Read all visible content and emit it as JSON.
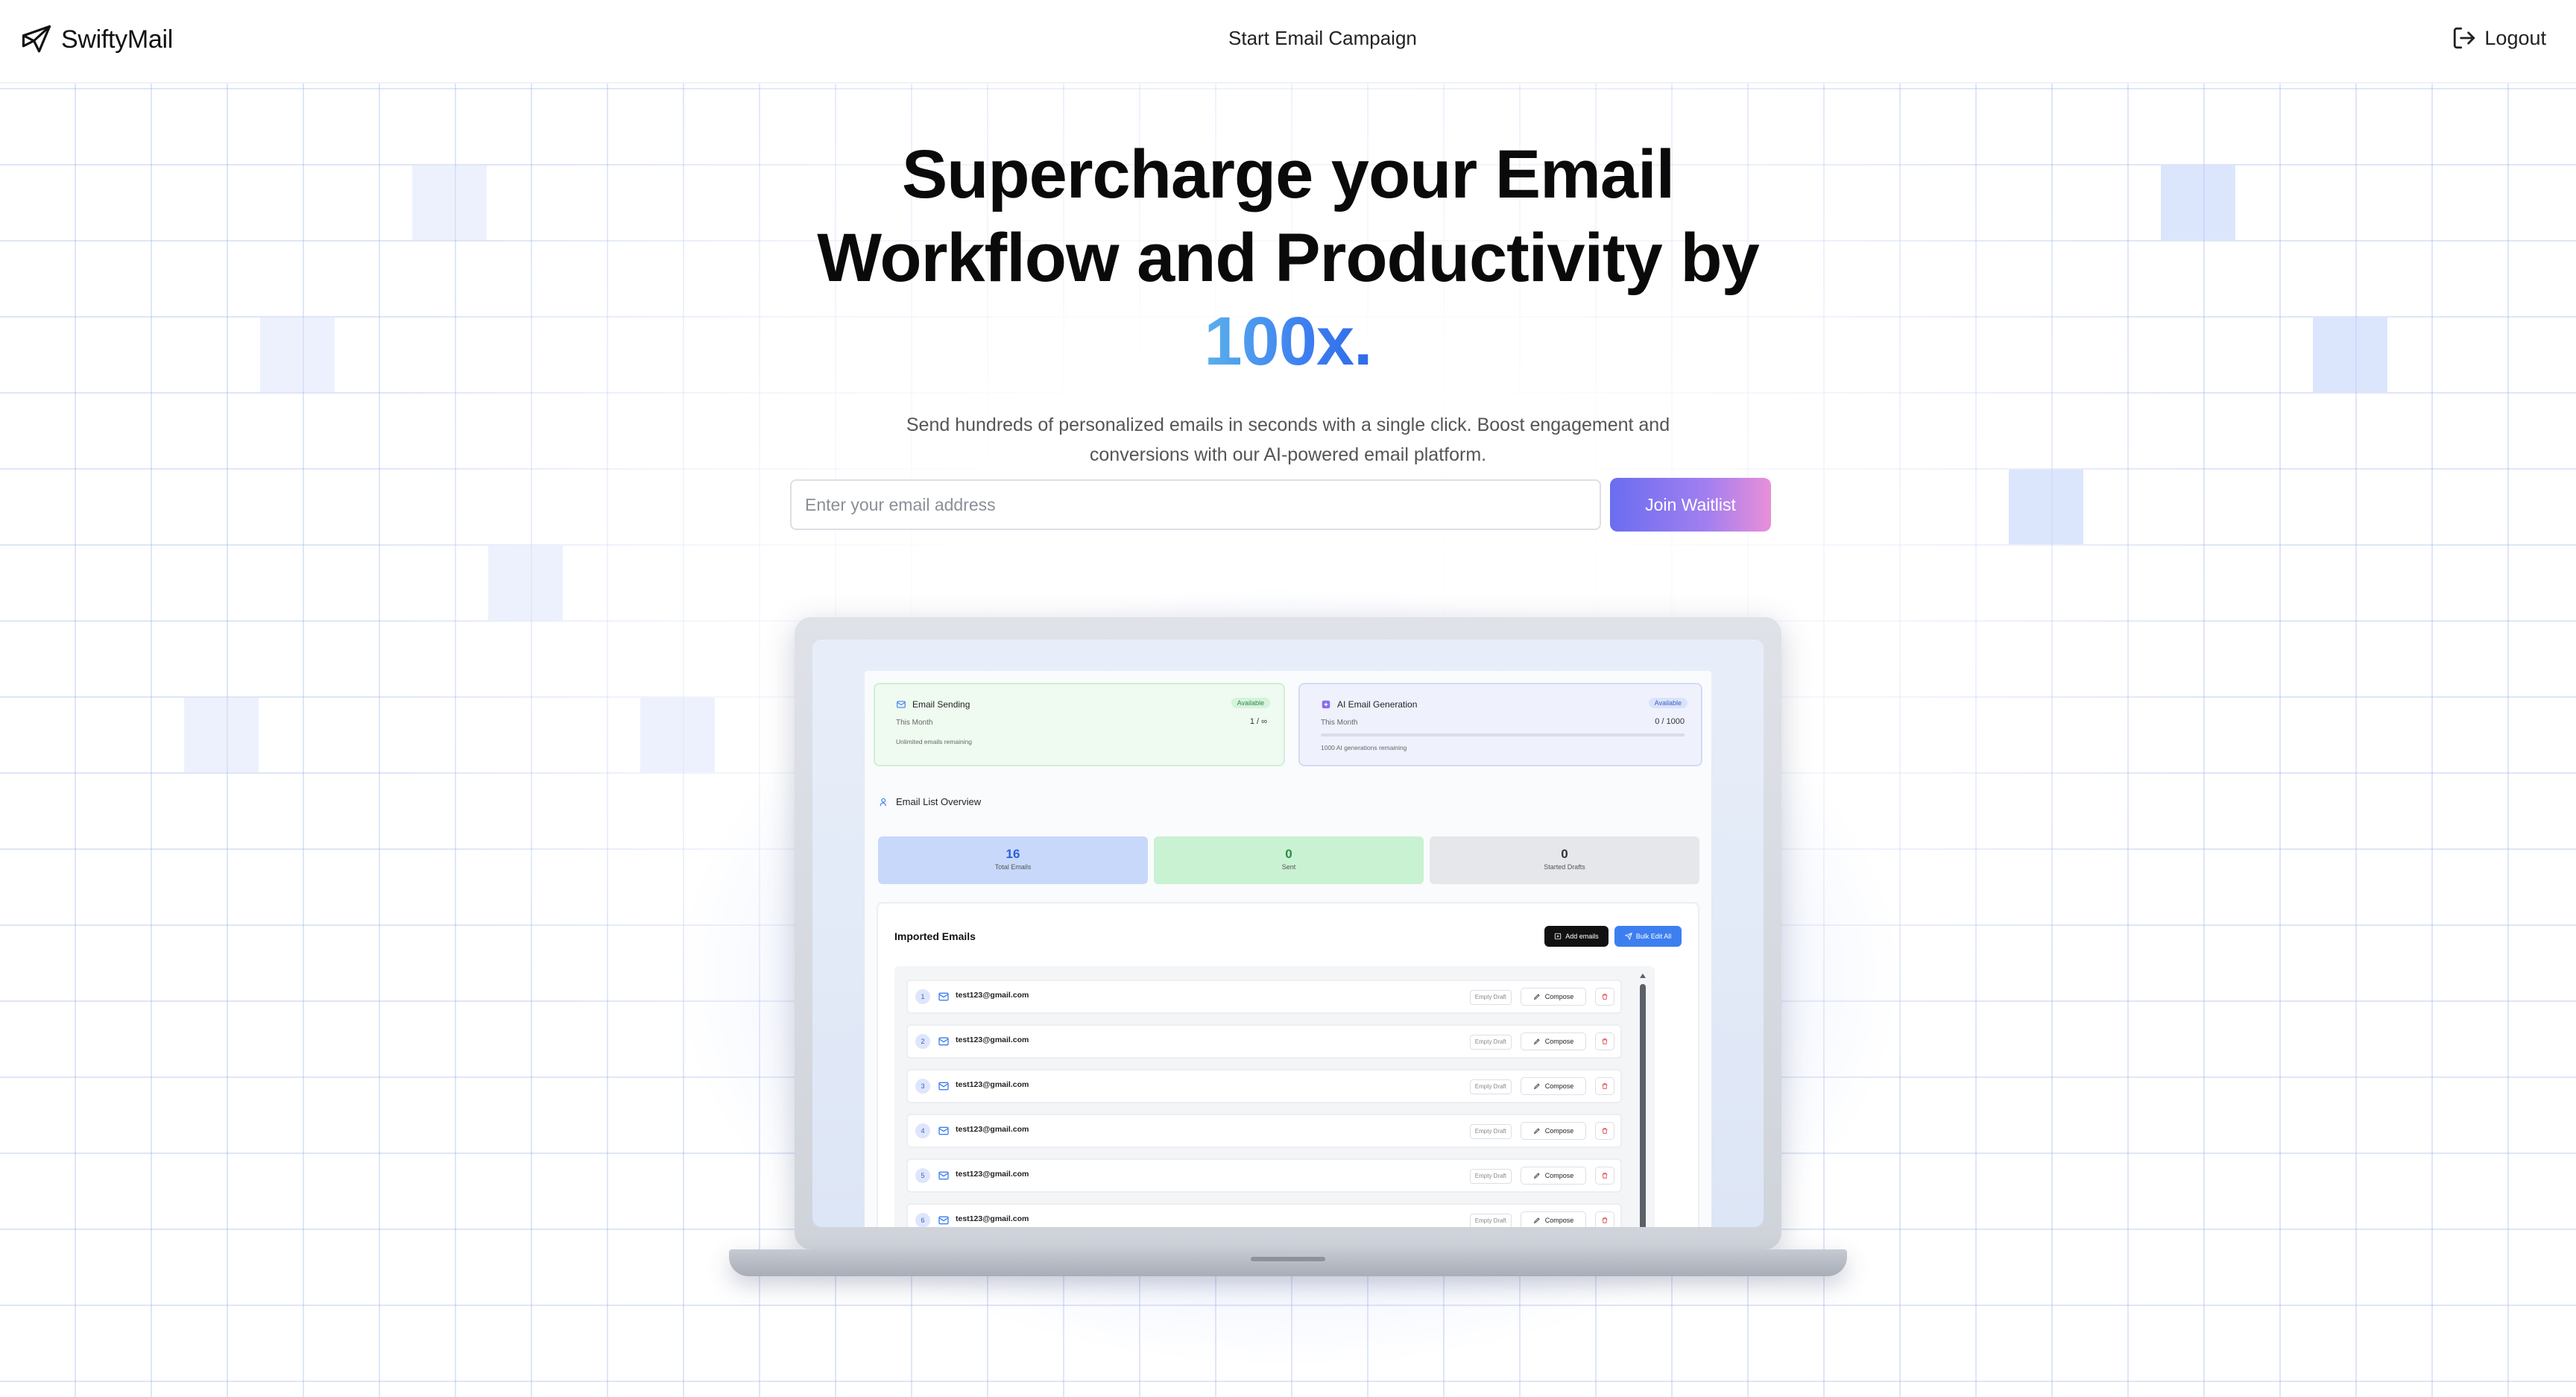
{
  "brand": {
    "name": "SwiftyMail"
  },
  "nav": {
    "center_link": "Start Email Campaign",
    "logout": "Logout"
  },
  "hero": {
    "title_line1": "Supercharge your Email",
    "title_line2": "Workflow and Productivity by",
    "title_accent": "100x.",
    "subtitle": "Send hundreds of personalized emails in seconds with a single click. Boost engagement and conversions with our AI-powered email platform."
  },
  "signup": {
    "placeholder": "Enter your email address",
    "value": "",
    "button": "Join Waitlist"
  },
  "colors": {
    "accent_blue": "#3d7ff0",
    "join_gradient_start": "#6a6df0",
    "join_gradient_end": "#e98fd8"
  },
  "preview": {
    "email_sending": {
      "title": "Email Sending",
      "badge": "Available",
      "period": "This Month",
      "count": "1 / ∞",
      "footnote": "Unlimited emails remaining"
    },
    "ai_generation": {
      "title": "AI Email Generation",
      "badge": "Available",
      "period": "This Month",
      "count": "0 / 1000",
      "footnote": "1000 AI generations remaining"
    },
    "overview_title": "Email List Overview",
    "stats": [
      {
        "value": "16",
        "label": "Total Emails"
      },
      {
        "value": "0",
        "label": "Sent"
      },
      {
        "value": "0",
        "label": "Started Drafts"
      }
    ],
    "imported": {
      "title": "Imported Emails",
      "add_button": "Add emails",
      "bulk_button": "Bulk Edit All",
      "rows": [
        {
          "index": "1",
          "email": "test123@gmail.com",
          "status": "Empty Draft",
          "action": "Compose"
        },
        {
          "index": "2",
          "email": "test123@gmail.com",
          "status": "Empty Draft",
          "action": "Compose"
        },
        {
          "index": "3",
          "email": "test123@gmail.com",
          "status": "Empty Draft",
          "action": "Compose"
        },
        {
          "index": "4",
          "email": "test123@gmail.com",
          "status": "Empty Draft",
          "action": "Compose"
        },
        {
          "index": "5",
          "email": "test123@gmail.com",
          "status": "Empty Draft",
          "action": "Compose"
        },
        {
          "index": "6",
          "email": "test123@gmail.com",
          "status": "Empty Draft",
          "action": "Compose"
        }
      ]
    }
  }
}
